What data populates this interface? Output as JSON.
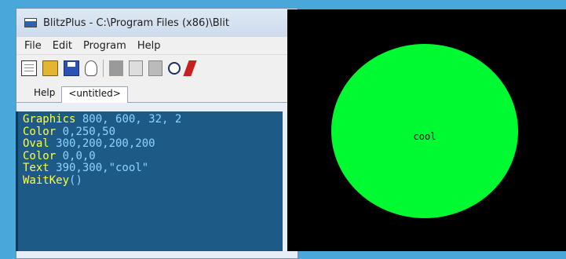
{
  "window": {
    "title": "BlitzPlus - C:\\Program Files (x86)\\Blit"
  },
  "menu": [
    "File",
    "Edit",
    "Program",
    "Help"
  ],
  "toolbar": [
    "new-file-icon",
    "open-folder-icon",
    "save-icon",
    "lightbulb-icon",
    "separator",
    "cut-icon",
    "copy-icon",
    "paste-icon",
    "find-icon",
    "run-icon"
  ],
  "tabs": [
    {
      "label": "Help"
    },
    {
      "label": "<untitled>"
    }
  ],
  "editor": {
    "lines": [
      {
        "kw": "Graphics",
        "args": " 800, 600, 32, 2"
      },
      {
        "kw": "Color",
        "args": " 0,250,50"
      },
      {
        "kw": "Oval",
        "args": " 300,200,200,200"
      },
      {
        "kw": "Color",
        "args": " 0,0,0"
      },
      {
        "kw": "Text",
        "args": " 390,300,\"cool\""
      },
      {
        "kw": "WaitKey",
        "args": "()"
      }
    ]
  },
  "canvas": {
    "text": "cool",
    "background": "#000000",
    "oval_color": "#00fa32",
    "text_color": "#000000"
  },
  "colors": {
    "desktop": "#4aa8d8",
    "editor_bg": "#1e5a86",
    "keyword": "#ffff3a",
    "value": "#8fd3ff"
  }
}
